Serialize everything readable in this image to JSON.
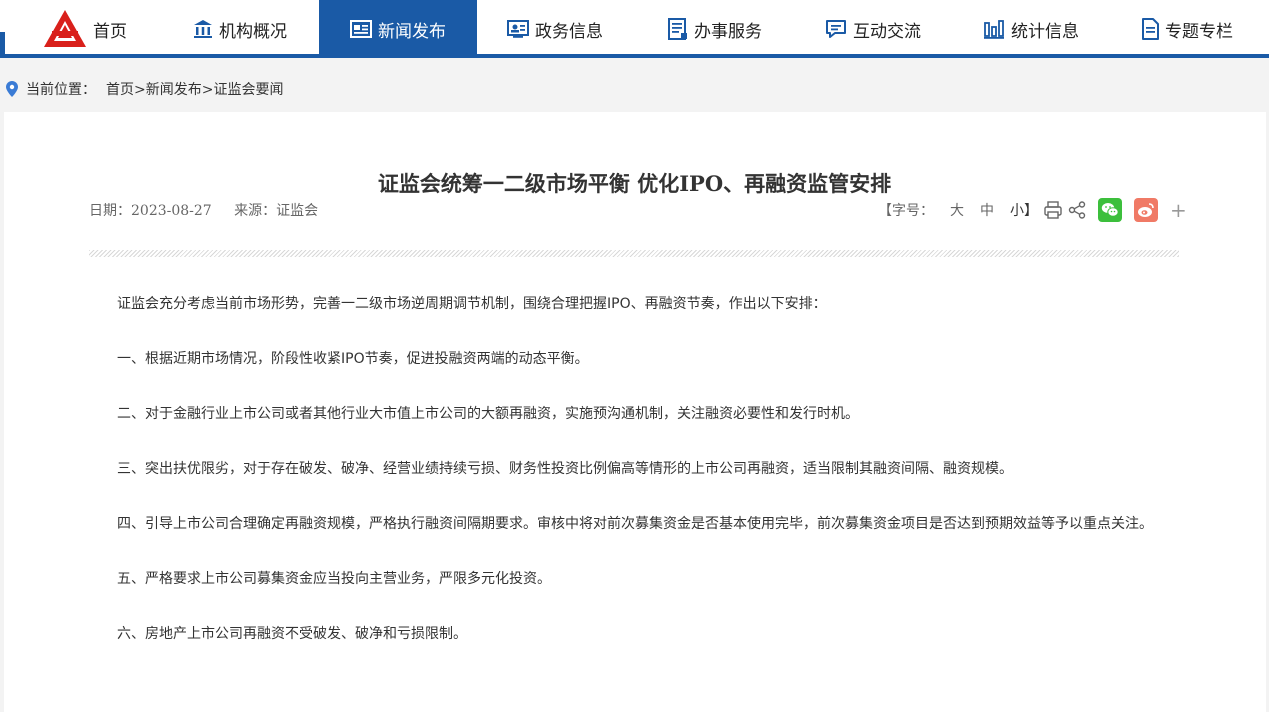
{
  "nav": {
    "items": [
      {
        "label": "首页",
        "icon": "logo-icon"
      },
      {
        "label": "机构概况",
        "icon": "institution-icon"
      },
      {
        "label": "新闻发布",
        "icon": "news-icon",
        "active": true
      },
      {
        "label": "政务信息",
        "icon": "id-card-icon"
      },
      {
        "label": "办事服务",
        "icon": "document-list-icon"
      },
      {
        "label": "互动交流",
        "icon": "chat-icon"
      },
      {
        "label": "统计信息",
        "icon": "bar-chart-icon"
      },
      {
        "label": "专题专栏",
        "icon": "file-icon"
      }
    ],
    "accent_color": "#1a5aa6",
    "logo_color": "#d9201b"
  },
  "breadcrumb": {
    "prefix": "当前位置：",
    "path": "首页>新闻发布>证监会要闻"
  },
  "article": {
    "title": "证监会统筹一二级市场平衡 优化IPO、再融资监管安排",
    "date": "日期：2023-08-27",
    "source": "来源：证监会",
    "font_size_label": "【字号：",
    "font_large": "大",
    "font_medium": "中",
    "font_small": "小】",
    "plus": "+",
    "paragraphs": [
      "证监会充分考虑当前市场形势，完善一二级市场逆周期调节机制，围绕合理把握IPO、再融资节奏，作出以下安排：",
      "一、根据近期市场情况，阶段性收紧IPO节奏，促进投融资两端的动态平衡。",
      "二、对于金融行业上市公司或者其他行业大市值上市公司的大额再融资，实施预沟通机制，关注融资必要性和发行时机。",
      "三、突出扶优限劣，对于存在破发、破净、经营业绩持续亏损、财务性投资比例偏高等情形的上市公司再融资，适当限制其融资间隔、融资规模。",
      "四、引导上市公司合理确定再融资规模，严格执行融资间隔期要求。审核中将对前次募集资金是否基本使用完毕，前次募集资金项目是否达到预期效益等予以重点关注。",
      "五、严格要求上市公司募集资金应当投向主营业务，严限多元化投资。",
      "六、房地产上市公司再融资不受破发、破净和亏损限制。"
    ]
  }
}
